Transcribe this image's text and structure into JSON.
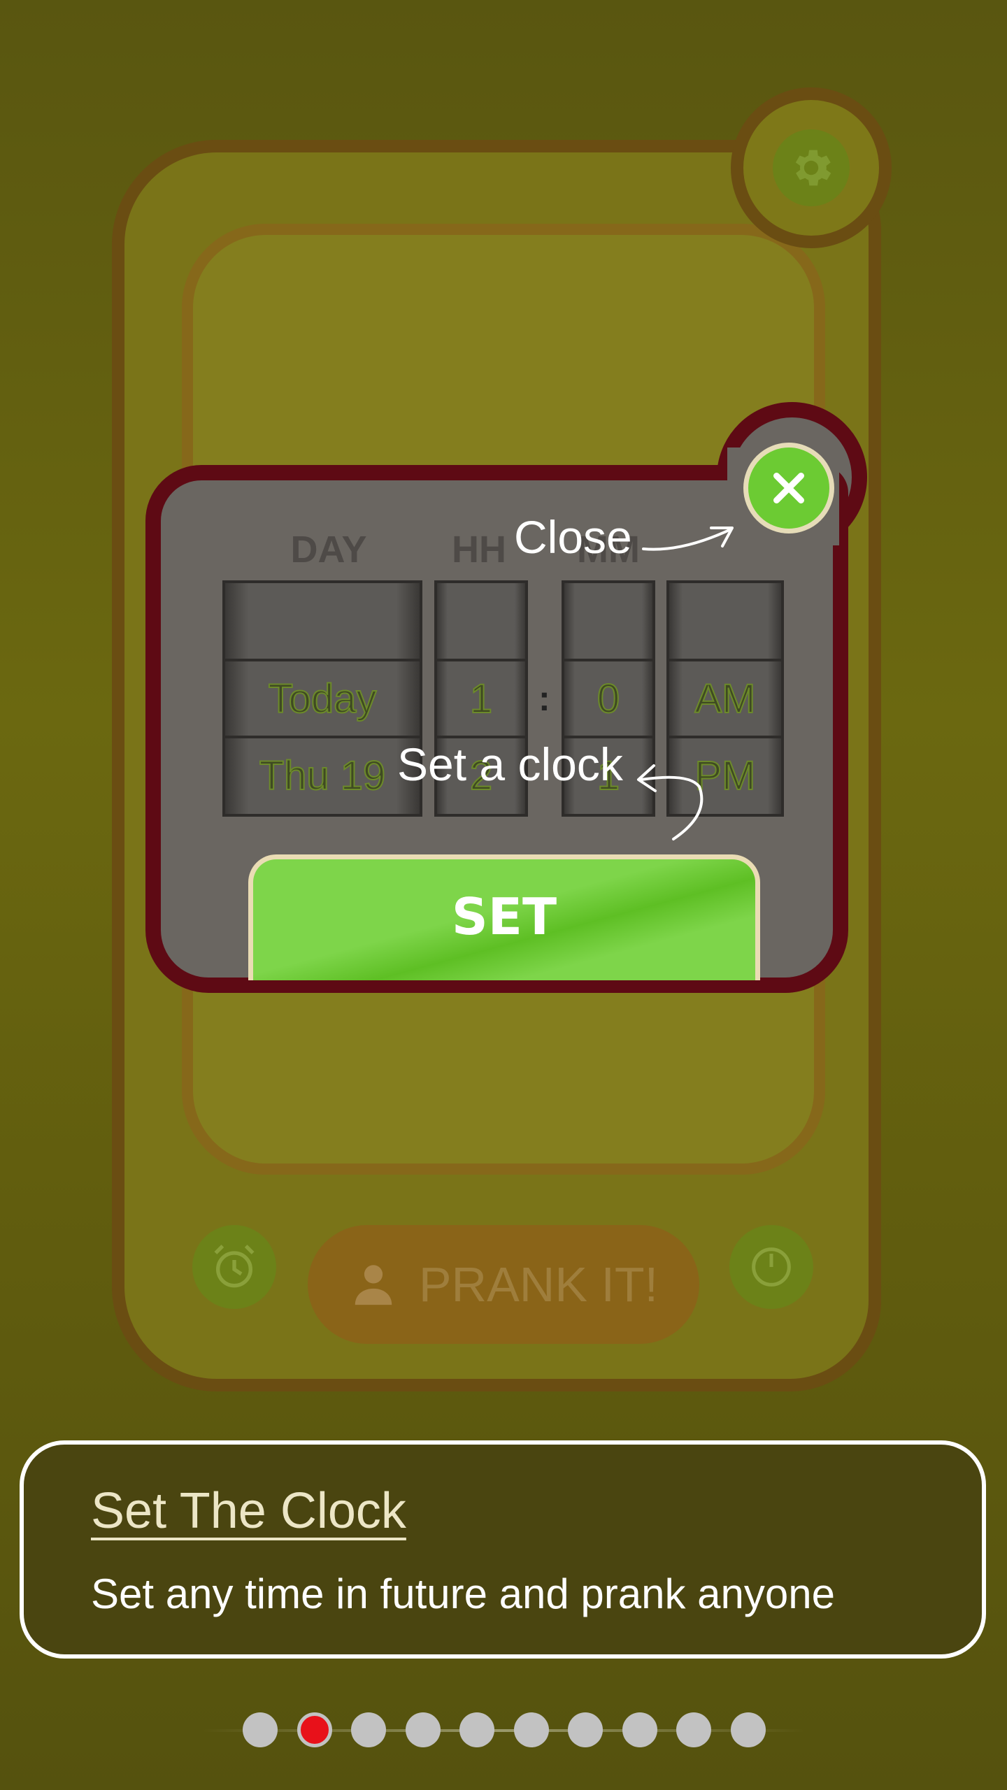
{
  "background_phone": {
    "prank_button_label": "PRANK IT!"
  },
  "dialog": {
    "columns": {
      "day": "DAY",
      "hh": "HH",
      "mm": "MM"
    },
    "day_picker": {
      "selected": "Today",
      "next": "Thu 19"
    },
    "hour_picker": {
      "selected": "1",
      "next": "2"
    },
    "minute_picker": {
      "selected": "0",
      "next": "1"
    },
    "ampm_picker": {
      "selected": "AM",
      "next": "PM"
    },
    "separator": ":",
    "set_button": "SET"
  },
  "hints": {
    "close": "Close",
    "set_clock": "Set a clock"
  },
  "info": {
    "title": "Set The Clock",
    "description": "Set any time in future and prank anyone"
  },
  "pager": {
    "total": 10,
    "current": 2
  },
  "colors": {
    "accent_green": "#6ccb33",
    "dialog_border": "#5e0a14",
    "active_dot": "#e8111a",
    "background": "#5a560e"
  },
  "icons": {
    "settings": "gear-icon",
    "close": "close-icon",
    "alarm": "alarm-clock-icon",
    "timer": "stopwatch-icon",
    "contact": "person-icon"
  }
}
